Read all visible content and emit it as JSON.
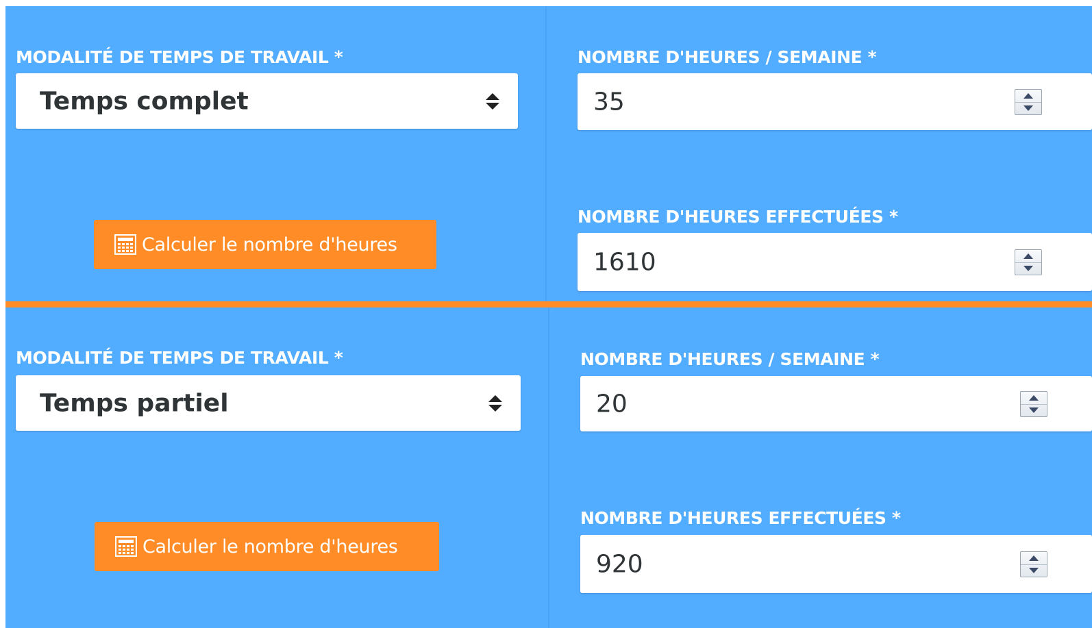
{
  "forms": [
    {
      "work_time_label": "MODALITÉ DE TEMPS DE TRAVAIL *",
      "work_time_value": "Temps complet",
      "hours_per_week_label": "NOMBRE D'HEURES / SEMAINE *",
      "hours_per_week_value": "35",
      "hours_done_label": "NOMBRE D'HEURES EFFECTUÉES *",
      "hours_done_value": "1610",
      "calc_button_label": "Calculer le nombre d'heures",
      "calc_button_icon": "calculator-icon"
    },
    {
      "work_time_label": "MODALITÉ DE TEMPS DE TRAVAIL *",
      "work_time_value": "Temps partiel",
      "hours_per_week_label": "NOMBRE D'HEURES / SEMAINE *",
      "hours_per_week_value": "20",
      "hours_done_label": "NOMBRE D'HEURES EFFECTUÉES *",
      "hours_done_value": "920",
      "calc_button_label": "Calculer le nombre d'heures",
      "calc_button_icon": "calculator-icon"
    }
  ],
  "colors": {
    "panel_background": "#52acff",
    "separator": "#ff8c26",
    "button_background": "#ff8c26",
    "label_text": "#ffffff",
    "input_text": "#2f3437"
  },
  "icons": {
    "select_arrows": "sort-arrows-icon",
    "spinner_up": "spinner-up-arrow-icon",
    "spinner_down": "spinner-down-arrow-icon"
  }
}
